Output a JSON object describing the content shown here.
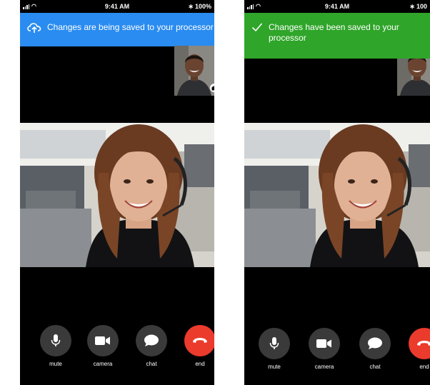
{
  "screens": [
    {
      "status": {
        "time": "9:41 AM",
        "battery": "100%"
      },
      "banner": {
        "text": "Changes are being saved to your processor",
        "color": "#2a8cf0",
        "icon": "cloud-upload-icon"
      },
      "controls": [
        {
          "label": "mute",
          "icon": "microphone-icon"
        },
        {
          "label": "camera",
          "icon": "video-camera-icon"
        },
        {
          "label": "chat",
          "icon": "chat-bubble-icon"
        },
        {
          "label": "end",
          "icon": "hang-up-icon"
        }
      ]
    },
    {
      "status": {
        "time": "9:41 AM",
        "battery": "100"
      },
      "banner": {
        "text": "Changes have been saved to your processor",
        "color": "#2fa52a",
        "icon": "checkmark-icon"
      },
      "controls": [
        {
          "label": "mute",
          "icon": "microphone-icon"
        },
        {
          "label": "camera",
          "icon": "video-camera-icon"
        },
        {
          "label": "chat",
          "icon": "chat-bubble-icon"
        },
        {
          "label": "end",
          "icon": "hang-up-icon"
        }
      ]
    }
  ],
  "colors": {
    "end_call": "#ea3b2d",
    "control_bg": "#3a3a3a",
    "background": "#000000"
  }
}
